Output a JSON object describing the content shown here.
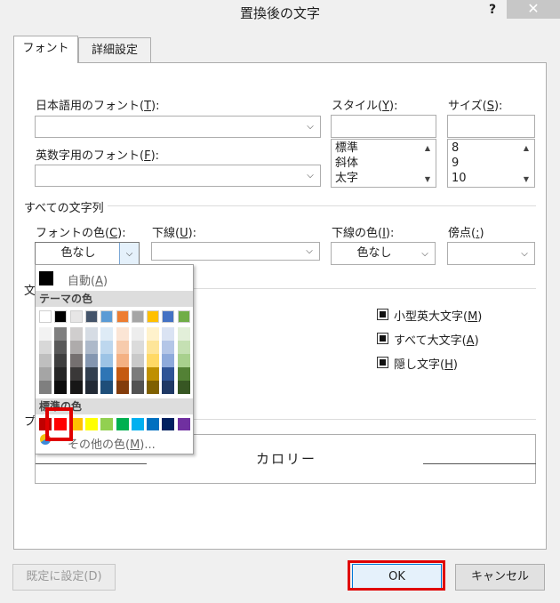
{
  "window": {
    "title": "置換後の文字",
    "help_label": "?",
    "close_label": "✕"
  },
  "tabs": [
    {
      "label": "フォント"
    },
    {
      "label": "詳細設定"
    }
  ],
  "font": {
    "jp_label": "日本語用のフォント(",
    "jp_key": "T",
    "jp_end": "):",
    "en_label": "英数字用のフォント(",
    "en_key": "F",
    "en_end": "):",
    "style_label": "スタイル(",
    "style_key": "Y",
    "style_end": "):",
    "size_label": "サイズ(",
    "size_key": "S",
    "size_end": "):",
    "style_items": [
      "標準",
      "斜体",
      "太字"
    ],
    "size_items": [
      "8",
      "9",
      "10"
    ]
  },
  "all_text": {
    "group_label": "すべての文字列",
    "color_label": "フォントの色(",
    "color_key": "C",
    "color_end": "):",
    "color_value": "色なし",
    "underline_label": "下線(",
    "underline_key": "U",
    "underline_end": "):",
    "underline_color_label": "下線の色(",
    "underline_color_key": "I",
    "underline_color_end": "):",
    "underline_color_value": "色なし",
    "emphasis_label": "傍点(",
    "emphasis_key": ":",
    "emphasis_end": ")"
  },
  "effects": {
    "group_label": "文",
    "items": [
      {
        "label_start": "小型英大文字(",
        "key": "M",
        "label_end": ")"
      },
      {
        "label_start": "すべて大文字(",
        "key": "A",
        "label_end": ")"
      },
      {
        "label_start": "隠し文字(",
        "key": "H",
        "label_end": ")"
      }
    ]
  },
  "preview": {
    "group_label": "プ",
    "text": "カロリー"
  },
  "buttons": {
    "default": "既定に設定(D)",
    "ok": "OK",
    "cancel": "キャンセル"
  },
  "color_popup": {
    "auto_label": "自動(",
    "auto_key": "A",
    "auto_end": ")",
    "theme_label": "テーマの色",
    "standard_label": "標準の色",
    "more_label": "その他の色(",
    "more_key": "M",
    "more_end": ")...",
    "theme_top": [
      "#ffffff",
      "#000000",
      "#e7e6e6",
      "#44546a",
      "#5b9bd5",
      "#ed7d31",
      "#a5a5a5",
      "#ffc000",
      "#4472c4",
      "#70ad47"
    ],
    "theme_shades": [
      [
        "#f2f2f2",
        "#7f7f7f",
        "#d0cece",
        "#d6dce4",
        "#deebf6",
        "#fbe5d5",
        "#ededed",
        "#fff2cc",
        "#dae3f3",
        "#e2efd9"
      ],
      [
        "#d8d8d8",
        "#595959",
        "#aeabab",
        "#adb9ca",
        "#bdd7ee",
        "#f7cbac",
        "#dbdbdb",
        "#fee599",
        "#b4c6e7",
        "#c5e0b3"
      ],
      [
        "#bfbfbf",
        "#3f3f3f",
        "#757070",
        "#8496b0",
        "#9cc3e5",
        "#f4b183",
        "#c9c9c9",
        "#ffd965",
        "#8eaadb",
        "#a8d08d"
      ],
      [
        "#a5a5a5",
        "#262626",
        "#3a3838",
        "#323f4f",
        "#2e75b5",
        "#c55a11",
        "#7b7b7b",
        "#bf9000",
        "#2f5496",
        "#538135"
      ],
      [
        "#7f7f7f",
        "#0c0c0c",
        "#171616",
        "#222a35",
        "#1e4e79",
        "#833c0b",
        "#525252",
        "#7f6000",
        "#1f3864",
        "#375623"
      ]
    ],
    "standard": [
      "#c00000",
      "#ff0000",
      "#ffc000",
      "#ffff00",
      "#92d050",
      "#00b050",
      "#00b0f0",
      "#0070c0",
      "#002060",
      "#7030a0"
    ]
  }
}
